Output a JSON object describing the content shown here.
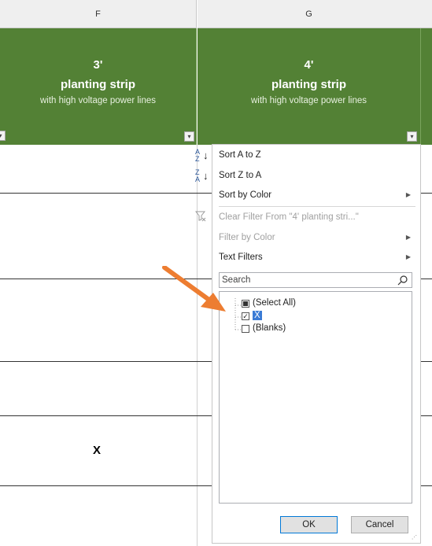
{
  "columns": [
    {
      "letter": "F",
      "line1": "3'",
      "line2": "planting strip",
      "line3": "with high voltage power lines"
    },
    {
      "letter": "G",
      "line1": "4'",
      "line2": "planting strip",
      "line3": "with high voltage power lines"
    }
  ],
  "cells": {
    "x_value": "X"
  },
  "menu": {
    "sort_az": "Sort A to Z",
    "sort_za": "Sort Z to A",
    "sort_color": "Sort by Color",
    "clear_filter": "Clear Filter From \"4'  planting stri...\"",
    "filter_color": "Filter by Color",
    "text_filters": "Text Filters",
    "search_placeholder": "Search",
    "items": [
      {
        "label": "(Select All)",
        "state": "partial"
      },
      {
        "label": "X",
        "state": "checked"
      },
      {
        "label": "(Blanks)",
        "state": "unchecked"
      }
    ],
    "ok": "OK",
    "cancel": "Cancel"
  },
  "icons": {
    "submenu": "chevron-right-icon",
    "search": "magnifier-icon",
    "clear": "clear-filter-icon"
  },
  "colors": {
    "header_green": "#538135",
    "annotation_arrow": "#ed7d31"
  }
}
